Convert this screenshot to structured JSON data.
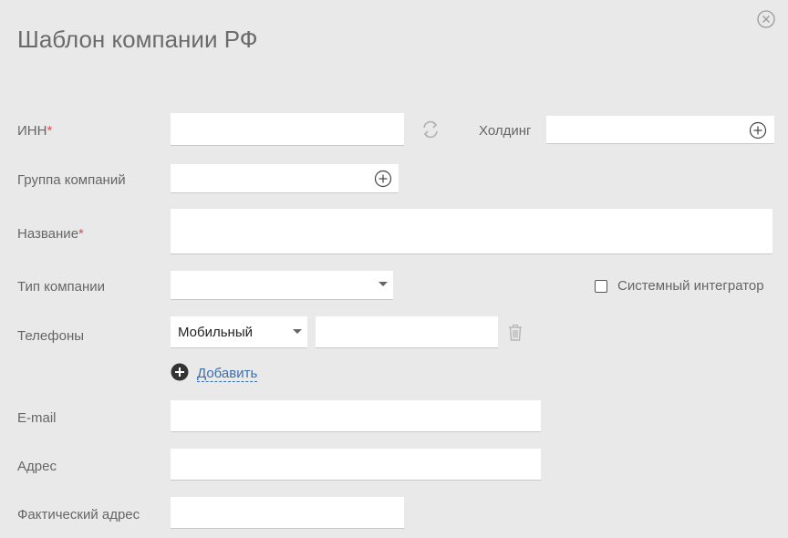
{
  "dialog": {
    "title": "Шаблон компании РФ"
  },
  "form": {
    "inn": {
      "label": "ИНН",
      "required_mark": "*",
      "value": ""
    },
    "holding": {
      "label": "Холдинг",
      "value": ""
    },
    "company_group": {
      "label": "Группа компаний",
      "value": ""
    },
    "name": {
      "label": "Название",
      "required_mark": "*",
      "value": ""
    },
    "company_type": {
      "label": "Тип компании",
      "selected": ""
    },
    "system_integrator": {
      "label": "Системный интегратор",
      "checked": false
    },
    "phones": {
      "label": "Телефоны",
      "type_selected": "Мобильный",
      "number": "",
      "add_label": "Добавить"
    },
    "email": {
      "label": "E-mail",
      "value": ""
    },
    "address": {
      "label": "Адрес",
      "value": ""
    },
    "actual_address": {
      "label": "Фактический адрес",
      "value": ""
    }
  },
  "icons": {
    "close": "close-icon",
    "refresh": "refresh-icon",
    "plus": "plus-circle-icon",
    "trash": "trash-icon",
    "add": "plus-filled-circle-icon"
  },
  "colors": {
    "background": "#e9e9e9",
    "required": "#d9534f",
    "link": "#3a6fb0"
  }
}
